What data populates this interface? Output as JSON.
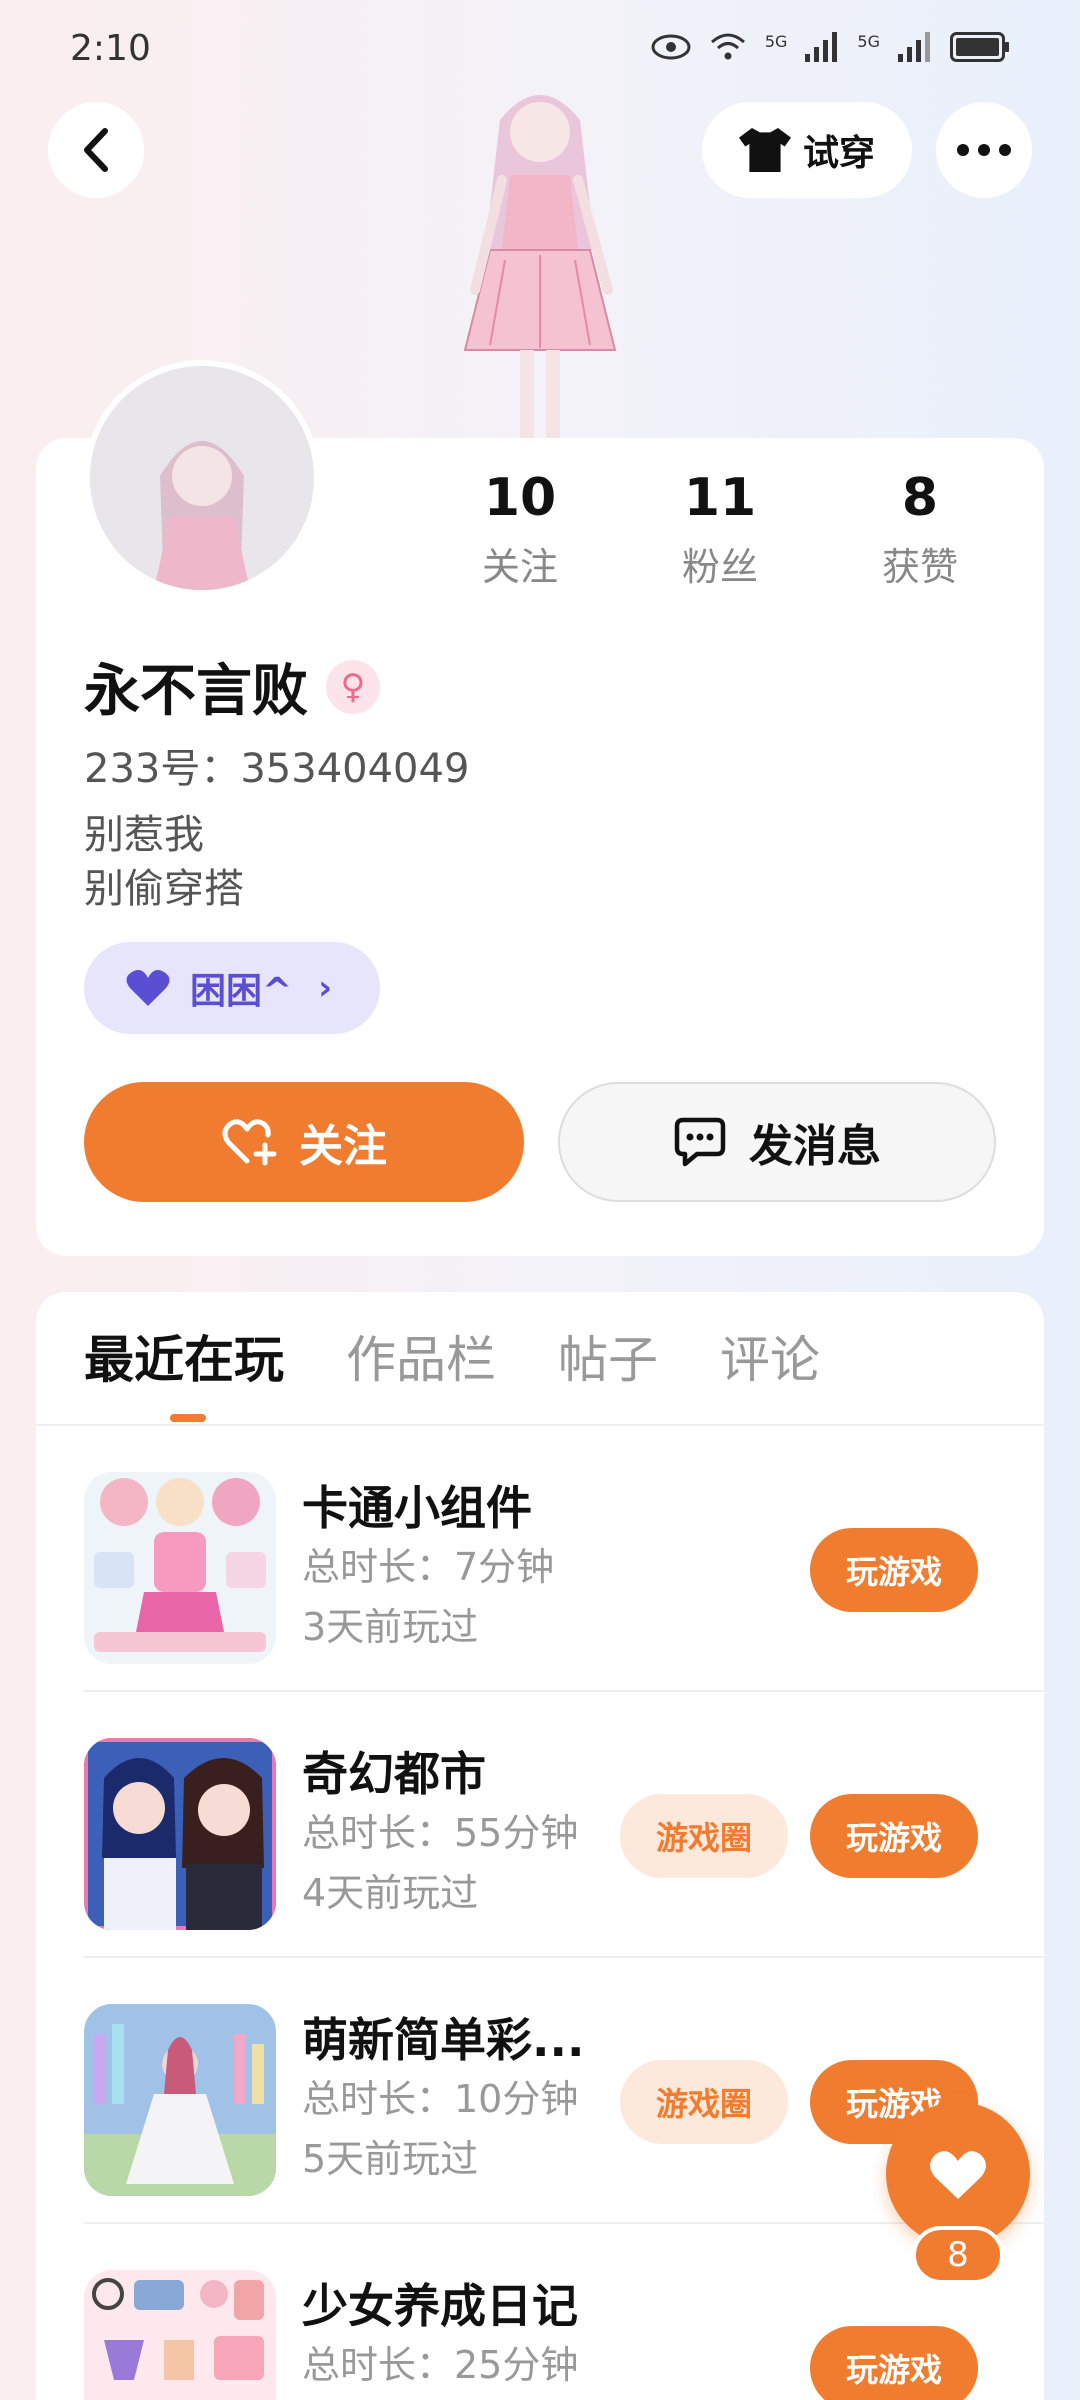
{
  "status_bar": {
    "time": "2:10",
    "net1": "5G",
    "net2": "5G"
  },
  "header": {
    "try_on_label": "试穿"
  },
  "profile": {
    "stats": [
      {
        "value": "10",
        "label": "关注"
      },
      {
        "value": "11",
        "label": "粉丝"
      },
      {
        "value": "8",
        "label": "获赞"
      }
    ],
    "name": "永不言败",
    "gender_icon": "female-icon",
    "uid": "233号：353404049",
    "bio_line1": "别惹我",
    "bio_line2": "别偷穿搭",
    "tag": "困困^",
    "follow_label": "关注",
    "message_label": "发消息"
  },
  "tabs": [
    "最近在玩",
    "作品栏",
    "帖子",
    "评论"
  ],
  "games": [
    {
      "title": "卡通小组件",
      "duration": "总时长：7分钟",
      "last_played": "3天前玩过",
      "play": "玩游戏"
    },
    {
      "title": "奇幻都市",
      "duration": "总时长：55分钟",
      "last_played": "4天前玩过",
      "circle": "游戏圈",
      "play": "玩游戏"
    },
    {
      "title": "萌新简单彩...",
      "duration": "总时长：10分钟",
      "last_played": "5天前玩过",
      "circle": "游戏圈",
      "play": "玩游戏"
    },
    {
      "title": "少女养成日记",
      "duration": "总时长：25分钟",
      "play": "玩游戏"
    }
  ],
  "fab": {
    "count": "8"
  },
  "colors": {
    "accent": "#f07c30",
    "purple": "#5a4fd3",
    "pink": "#f06a8c"
  }
}
